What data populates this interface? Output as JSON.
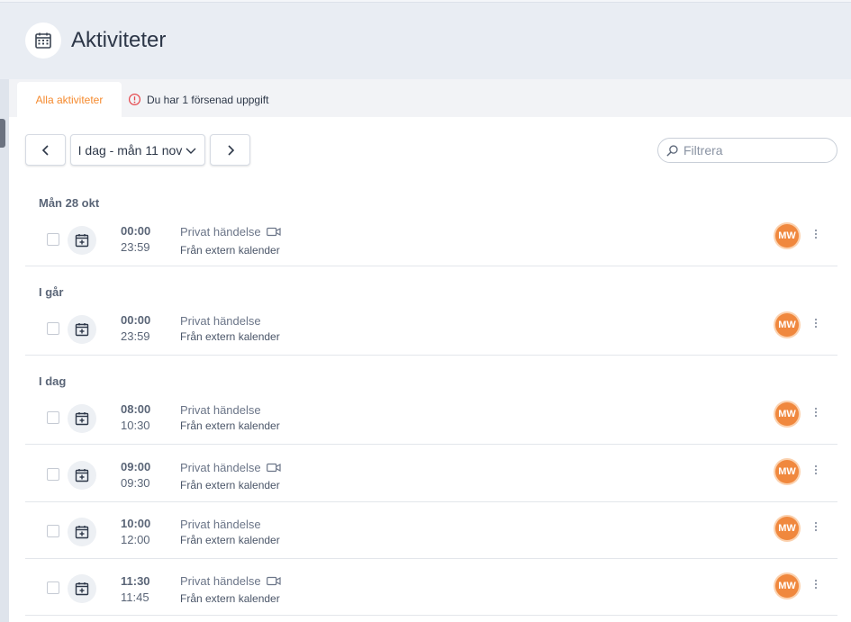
{
  "page": {
    "title": "Aktiviteter"
  },
  "tabs": {
    "active_label": "Alla aktiviteter",
    "warning_label": "Du har 1 försenad uppgift"
  },
  "toolbar": {
    "date_label": "I dag - mån 11 nov",
    "filter_placeholder": "Filtrera"
  },
  "colors": {
    "accent": "#f58a2e",
    "avatar": "#f0883e",
    "warning": "#e5484d"
  },
  "groups": [
    {
      "label": "Mån 28 okt"
    },
    {
      "label": "I går"
    },
    {
      "label": "I dag"
    }
  ],
  "events": [
    {
      "start": "00:00",
      "end": "23:59",
      "title": "Privat händelse",
      "subtitle": "Från extern kalender",
      "avatar": "MW",
      "has_video_icon": true
    },
    {
      "start": "00:00",
      "end": "23:59",
      "title": "Privat händelse",
      "subtitle": "Från extern kalender",
      "avatar": "MW",
      "has_video_icon": false
    },
    {
      "start": "08:00",
      "end": "10:30",
      "title": "Privat händelse",
      "subtitle": "Från extern kalender",
      "avatar": "MW",
      "has_video_icon": false
    },
    {
      "start": "09:00",
      "end": "09:30",
      "title": "Privat händelse",
      "subtitle": "Från extern kalender",
      "avatar": "MW",
      "has_video_icon": true
    },
    {
      "start": "10:00",
      "end": "12:00",
      "title": "Privat händelse",
      "subtitle": "Från extern kalender",
      "avatar": "MW",
      "has_video_icon": false
    },
    {
      "start": "11:30",
      "end": "11:45",
      "title": "Privat händelse",
      "subtitle": "Från extern kalender",
      "avatar": "MW",
      "has_video_icon": true
    }
  ]
}
